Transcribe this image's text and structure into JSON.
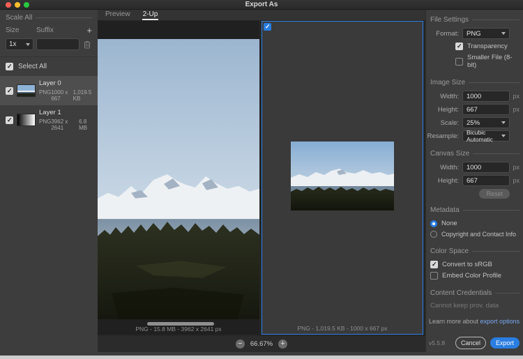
{
  "titlebar": {
    "title": "Export As"
  },
  "scale_all": {
    "header": "Scale All",
    "size_label": "Size",
    "suffix_label": "Suffix",
    "add_button": "+",
    "scale_value": "1x",
    "suffix_value": ""
  },
  "select_all": {
    "label": "Select All",
    "checked": true
  },
  "layers": [
    {
      "name": "Layer 0",
      "format": "PNG",
      "dimensions": "1000 x 667",
      "size": "1,019.5 KB",
      "checked": true,
      "selected": true
    },
    {
      "name": "Layer 1",
      "format": "PNG",
      "dimensions": "3962 x 2641",
      "size": "6.8 MB",
      "checked": true,
      "selected": false
    }
  ],
  "preview": {
    "tabs": [
      {
        "label": "Preview",
        "active": false
      },
      {
        "label": "2-Up",
        "active": true
      }
    ],
    "panes": [
      {
        "caption": "PNG - 15.8 MB - 3962 x 2641 px",
        "selected": false
      },
      {
        "caption": "PNG - 1,019.5 KB - 1000 x 667 px",
        "selected": true,
        "checkbox_checked": true
      }
    ],
    "zoom": {
      "minus": "−",
      "value": "66.67%",
      "plus": "+"
    }
  },
  "file_settings": {
    "header": "File Settings",
    "format_label": "Format:",
    "format_value": "PNG",
    "transparency": {
      "label": "Transparency",
      "checked": true
    },
    "smaller_file": {
      "label": "Smaller File (8-bit)",
      "checked": false
    }
  },
  "image_size": {
    "header": "Image Size",
    "width_label": "Width:",
    "width_value": "1000",
    "width_unit": "px",
    "height_label": "Height:",
    "height_value": "667",
    "height_unit": "px",
    "scale_label": "Scale:",
    "scale_value": "25%",
    "resample_label": "Resample:",
    "resample_value": "Bicubic Automatic"
  },
  "canvas_size": {
    "header": "Canvas Size",
    "width_label": "Width:",
    "width_value": "1000",
    "width_unit": "px",
    "height_label": "Height:",
    "height_value": "667",
    "height_unit": "px",
    "reset_button": "Reset"
  },
  "metadata": {
    "header": "Metadata",
    "options": [
      {
        "label": "None",
        "selected": true
      },
      {
        "label": "Copyright and Contact Info",
        "selected": false
      }
    ]
  },
  "color_space": {
    "header": "Color Space",
    "convert": {
      "label": "Convert to sRGB",
      "checked": true
    },
    "embed": {
      "label": "Embed Color Profile",
      "checked": false
    }
  },
  "content_credentials": {
    "header": "Content Credentials",
    "status": "Cannot keep prov. data"
  },
  "learn_more": {
    "prefix": "Learn more about ",
    "link_text": "export options"
  },
  "footer": {
    "version": "v5.5.8",
    "cancel_button": "Cancel",
    "export_button": "Export"
  },
  "colors": {
    "accent_blue": "#2a7de1",
    "link_blue": "#79a8f2",
    "traffic_red": "#ff5f57",
    "traffic_yellow": "#febc2e",
    "traffic_green": "#28c840"
  }
}
